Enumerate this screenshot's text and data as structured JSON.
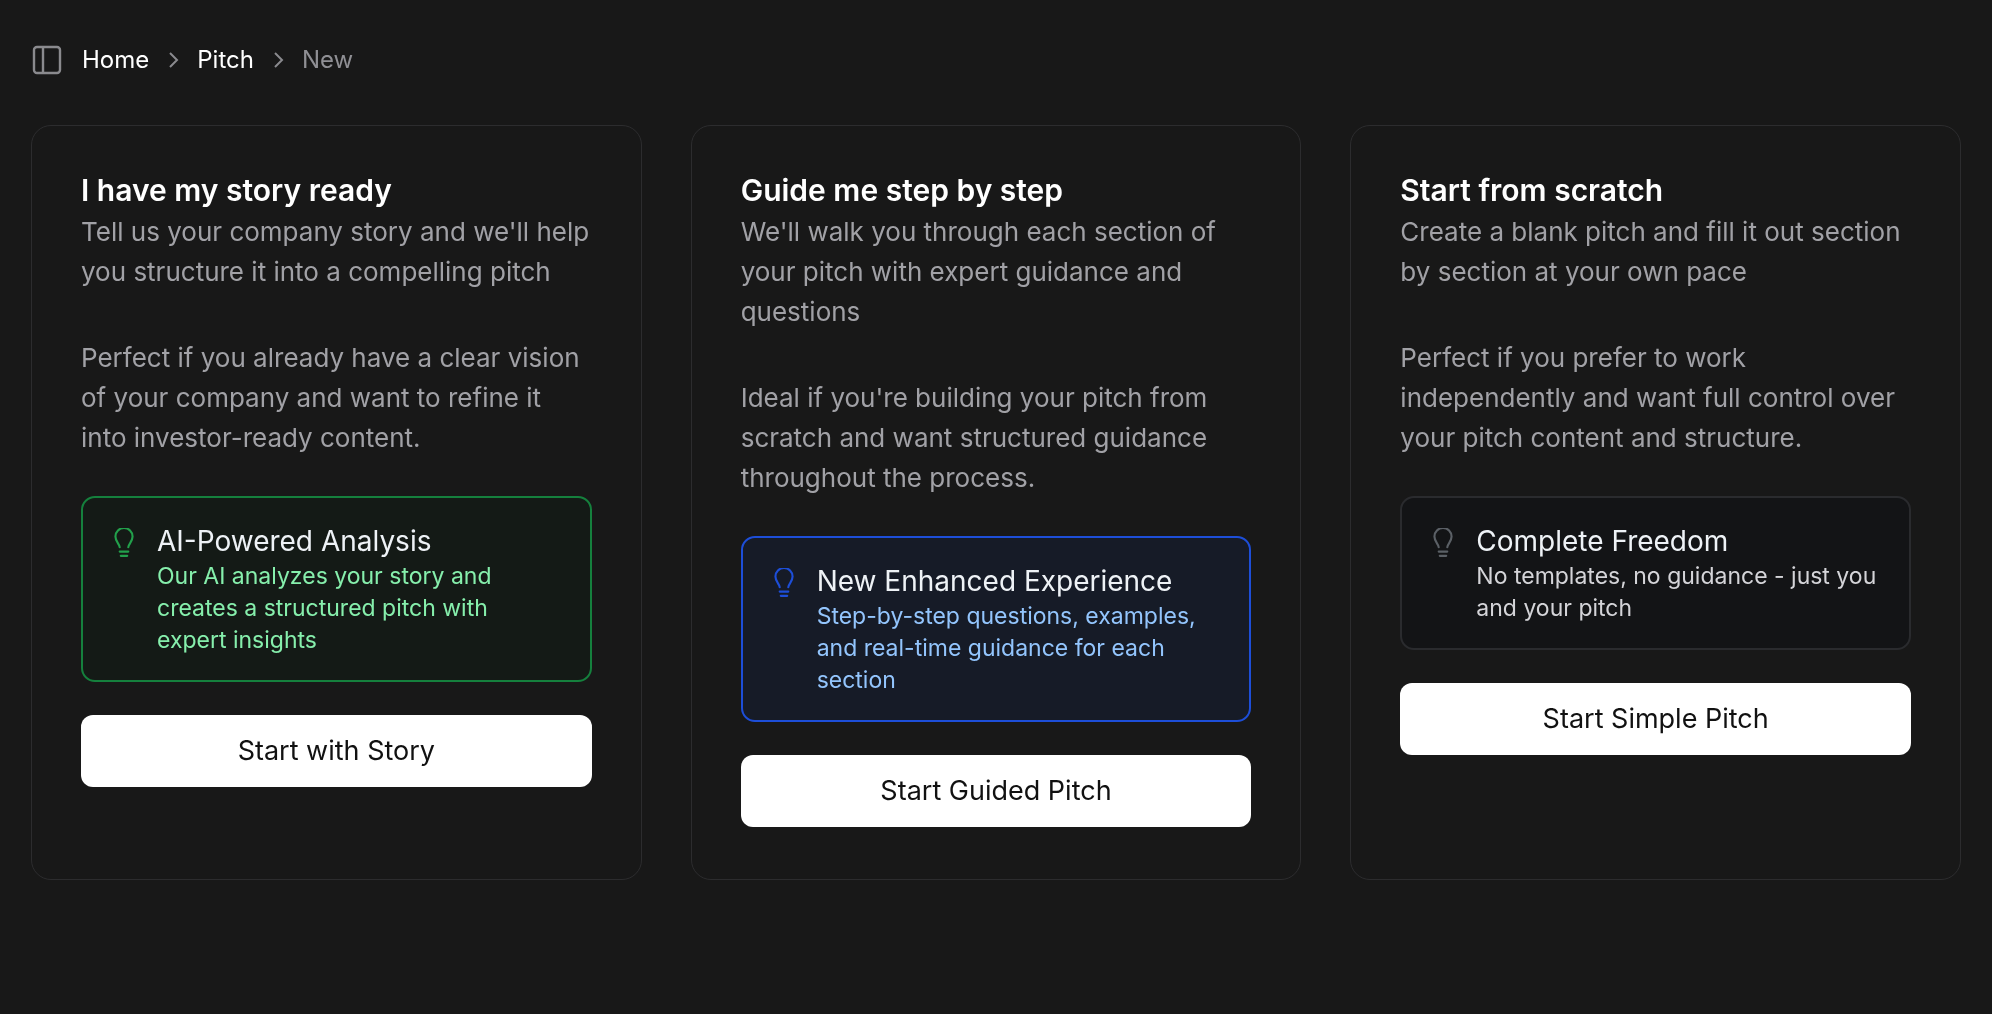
{
  "breadcrumb": [
    {
      "label": "Home",
      "current": false
    },
    {
      "label": "Pitch",
      "current": false
    },
    {
      "label": "New",
      "current": true
    }
  ],
  "cards": [
    {
      "title": "I have my story ready",
      "description": "Tell us your company story and we'll help you structure it into a compelling pitch",
      "detail": "Perfect if you already have a clear vision of your company and want to refine it into investor-ready content.",
      "callout": {
        "kind": "success",
        "title": "AI-Powered Analysis",
        "text": "Our AI analyzes your story and creates a structured pitch with expert insights"
      },
      "button": "Start with Story"
    },
    {
      "title": "Guide me step by step",
      "description": "We'll walk you through each section of your pitch with expert guidance and questions",
      "detail": "Ideal if you're building your pitch from scratch and want structured guidance throughout the process.",
      "callout": {
        "kind": "info",
        "title": "New Enhanced Experience",
        "text": "Step-by-step questions, examples, and real-time guidance for each section"
      },
      "button": "Start Guided Pitch"
    },
    {
      "title": "Start from scratch",
      "description": "Create a blank pitch and fill it out section by section at your own pace",
      "detail": "Perfect if you prefer to work independently and want full control over your pitch content and structure.",
      "callout": {
        "kind": "plain",
        "title": "Complete Freedom",
        "text": "No templates, no guidance - just you and your pitch"
      },
      "button": "Start Simple Pitch"
    }
  ]
}
